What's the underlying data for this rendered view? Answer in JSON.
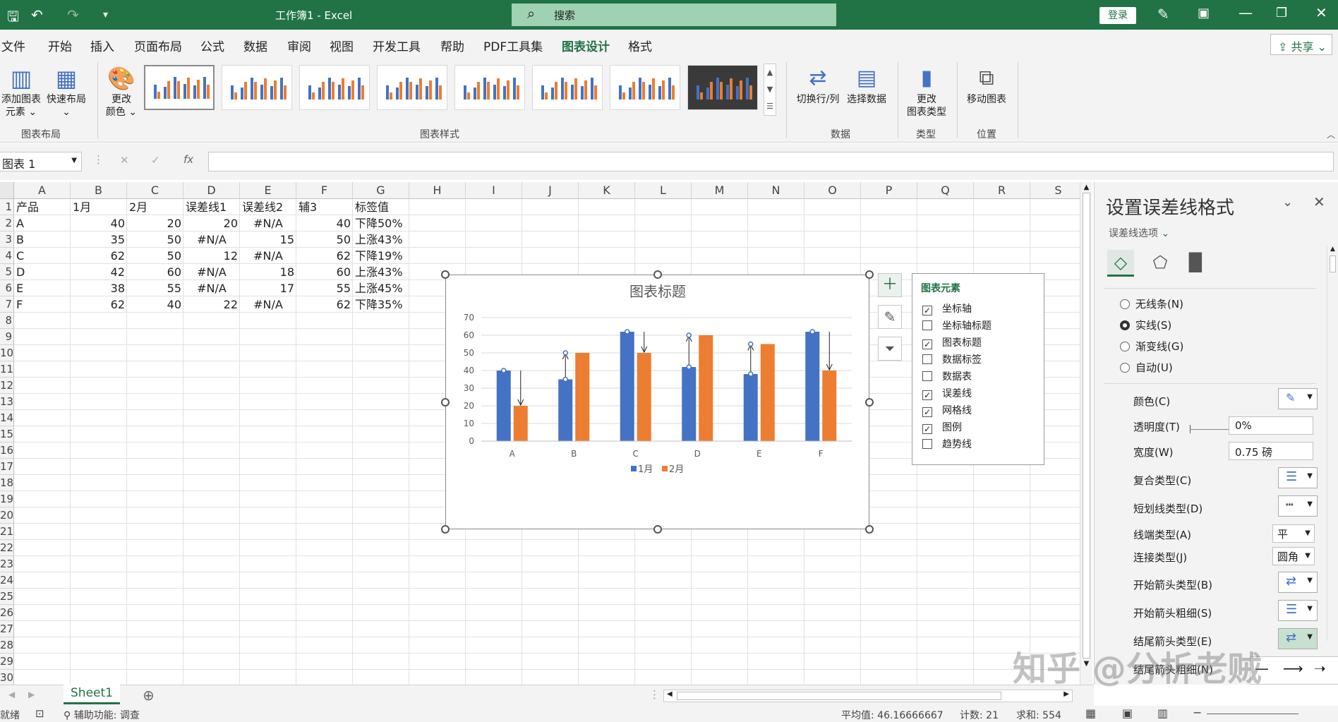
{
  "app": {
    "title": "工作簿1 - Excel",
    "search_placeholder": "搜索",
    "login": "登录",
    "share": "共享"
  },
  "menu": [
    "文件",
    "开始",
    "插入",
    "页面布局",
    "公式",
    "数据",
    "审阅",
    "视图",
    "开发工具",
    "帮助",
    "PDF工具集",
    "图表设计",
    "格式"
  ],
  "menu_active": "图表设计",
  "ribbon": {
    "add_element": "添加图表",
    "add_element2": "元素 ⌄",
    "quick_layout": "快速布局",
    "quick_layout2": "⌄",
    "change_color": "更改",
    "change_color2": "颜色 ⌄",
    "group_layout": "图表布局",
    "group_styles": "图表样式",
    "switch_rowcol": "切换行/列",
    "select_data": "选择数据",
    "group_data": "数据",
    "change_type": "更改",
    "change_type2": "图表类型",
    "group_type": "类型",
    "move_chart": "移动图表",
    "group_location": "位置"
  },
  "formula": {
    "namebox": "图表 1",
    "cancel": "✕",
    "enter": "✓",
    "fx": "fx",
    "value": ""
  },
  "sheet": {
    "columns": [
      "A",
      "B",
      "C",
      "D",
      "E",
      "F",
      "G",
      "H",
      "I",
      "J",
      "K",
      "L",
      "M",
      "N",
      "O",
      "P",
      "Q",
      "R",
      "S"
    ],
    "rows": [
      "1",
      "2",
      "3",
      "4",
      "5",
      "6",
      "7",
      "8",
      "9",
      "10",
      "11",
      "12",
      "13",
      "14",
      "15",
      "16",
      "17",
      "18",
      "19",
      "20",
      "21",
      "22",
      "23",
      "24",
      "25",
      "26",
      "27",
      "28",
      "29",
      "30"
    ],
    "header": [
      "产品",
      "1月",
      "2月",
      "误差线1",
      "误差线2",
      "辅3",
      "标签值"
    ],
    "data": [
      [
        "A",
        "40",
        "20",
        "20",
        "#N/A",
        "40",
        "下降50%"
      ],
      [
        "B",
        "35",
        "50",
        "#N/A",
        "15",
        "50",
        "上涨43%"
      ],
      [
        "C",
        "62",
        "50",
        "12",
        "#N/A",
        "62",
        "下降19%"
      ],
      [
        "D",
        "42",
        "60",
        "#N/A",
        "18",
        "60",
        "上涨43%"
      ],
      [
        "E",
        "38",
        "55",
        "#N/A",
        "17",
        "55",
        "上涨45%"
      ],
      [
        "F",
        "62",
        "40",
        "22",
        "#N/A",
        "62",
        "下降35%"
      ]
    ],
    "tab": "Sheet1"
  },
  "chart_data": {
    "type": "bar",
    "title": "图表标题",
    "categories": [
      "A",
      "B",
      "C",
      "D",
      "E",
      "F"
    ],
    "series": [
      {
        "name": "1月",
        "values": [
          40,
          35,
          62,
          42,
          38,
          62
        ],
        "color": "#4472c4"
      },
      {
        "name": "2月",
        "values": [
          20,
          50,
          50,
          60,
          55,
          40
        ],
        "color": "#ed7d31"
      }
    ],
    "ylim": [
      0,
      70
    ],
    "yticks": [
      "0",
      "10",
      "20",
      "30",
      "40",
      "50",
      "60",
      "70"
    ],
    "grid": true,
    "legend": "bottom",
    "error_bars": "down/up arrows between months"
  },
  "chart_elements": {
    "title": "图表元素",
    "items": [
      {
        "label": "坐标轴",
        "checked": true
      },
      {
        "label": "坐标轴标题",
        "checked": false
      },
      {
        "label": "图表标题",
        "checked": true
      },
      {
        "label": "数据标签",
        "checked": false
      },
      {
        "label": "数据表",
        "checked": false
      },
      {
        "label": "误差线",
        "checked": true
      },
      {
        "label": "网格线",
        "checked": true
      },
      {
        "label": "图例",
        "checked": true
      },
      {
        "label": "趋势线",
        "checked": false
      }
    ]
  },
  "pane": {
    "title": "设置误差线格式",
    "subtitle": "误差线选项",
    "radios": [
      {
        "label": "无线条(N)",
        "on": false
      },
      {
        "label": "实线(S)",
        "on": true
      },
      {
        "label": "渐变线(G)",
        "on": false
      },
      {
        "label": "自动(U)",
        "on": false
      }
    ],
    "color": "颜色(C)",
    "transparency": "透明度(T)",
    "transparency_val": "0%",
    "width": "宽度(W)",
    "width_val": "0.75 磅",
    "compound": "复合类型(C)",
    "dash": "短划线类型(D)",
    "cap": "线端类型(A)",
    "cap_val": "平",
    "join": "连接类型(J)",
    "join_val": "圆角",
    "begin_arrow": "开始箭头类型(B)",
    "begin_size": "开始箭头粗细(S)",
    "end_arrow": "结尾箭头类型(E)",
    "end_size": "结尾箭头粗细(N)"
  },
  "status": {
    "ready": "就绪",
    "accessibility": "辅助功能: 调查",
    "average": "平均值: 46.16666667",
    "count": "计数: 21",
    "sum": "求和: 554"
  },
  "watermark": "知乎 @分析老贼"
}
